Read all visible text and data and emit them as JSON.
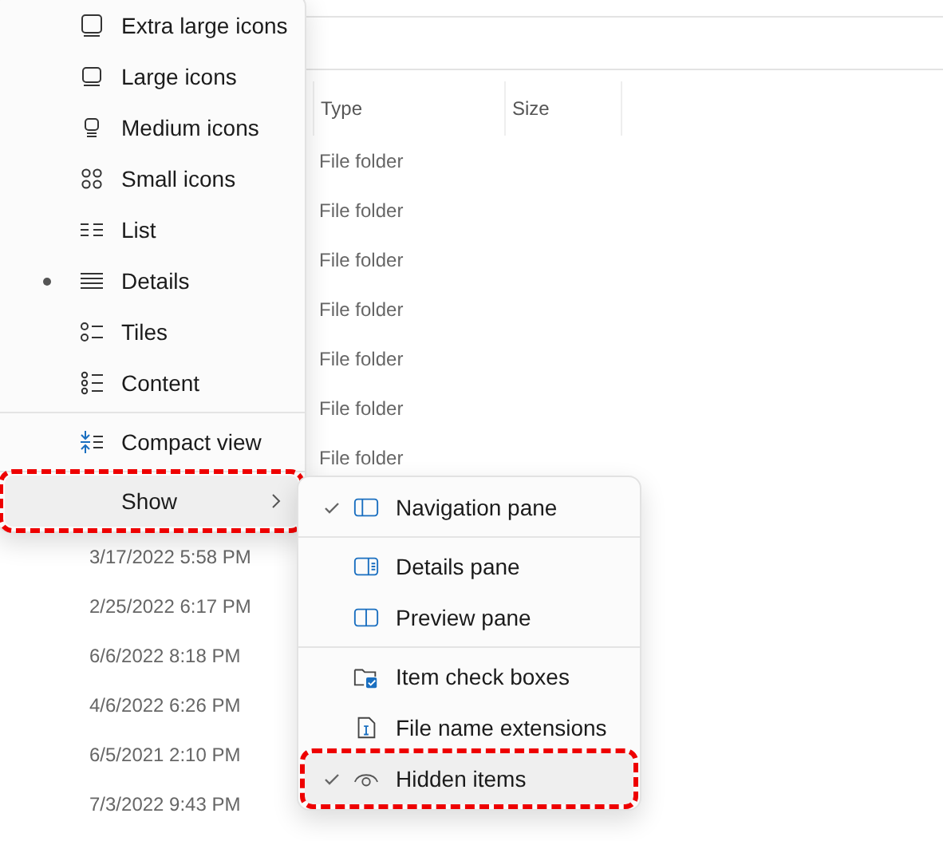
{
  "columns": [
    {
      "label": "Type"
    },
    {
      "label": "Size"
    }
  ],
  "type_cells": [
    "File folder",
    "File folder",
    "File folder",
    "File folder",
    "File folder",
    "File folder",
    "File folder"
  ],
  "date_cells": [
    "3/17/2022 5:58 PM",
    "2/25/2022 6:17 PM",
    "6/6/2022 8:18 PM",
    "4/6/2022 6:26 PM",
    "6/5/2021 2:10 PM",
    "7/3/2022 9:43 PM"
  ],
  "view_menu": {
    "layouts": [
      {
        "label": "Extra large icons",
        "kind": "xl",
        "selected": false
      },
      {
        "label": "Large icons",
        "kind": "large",
        "selected": false
      },
      {
        "label": "Medium icons",
        "kind": "medium",
        "selected": false
      },
      {
        "label": "Small icons",
        "kind": "small",
        "selected": false
      },
      {
        "label": "List",
        "kind": "list",
        "selected": false
      },
      {
        "label": "Details",
        "kind": "details",
        "selected": true
      },
      {
        "label": "Tiles",
        "kind": "tiles",
        "selected": false
      },
      {
        "label": "Content",
        "kind": "content",
        "selected": false
      }
    ],
    "compact": {
      "label": "Compact view"
    },
    "show": {
      "label": "Show",
      "highlighted": true,
      "annotated": true
    }
  },
  "show_menu": {
    "groups": [
      [
        {
          "label": "Navigation pane",
          "kind": "nav",
          "checked": true,
          "highlighted": false,
          "annotated": false
        }
      ],
      [
        {
          "label": "Details pane",
          "kind": "detailspane",
          "checked": false,
          "highlighted": false,
          "annotated": false
        },
        {
          "label": "Preview pane",
          "kind": "preview",
          "checked": false,
          "highlighted": false,
          "annotated": false
        }
      ],
      [
        {
          "label": "Item check boxes",
          "kind": "checkboxes",
          "checked": false,
          "highlighted": false,
          "annotated": false
        },
        {
          "label": "File name extensions",
          "kind": "extensions",
          "checked": false,
          "highlighted": false,
          "annotated": false
        },
        {
          "label": "Hidden items",
          "kind": "hidden",
          "checked": true,
          "highlighted": true,
          "annotated": true
        }
      ]
    ]
  }
}
